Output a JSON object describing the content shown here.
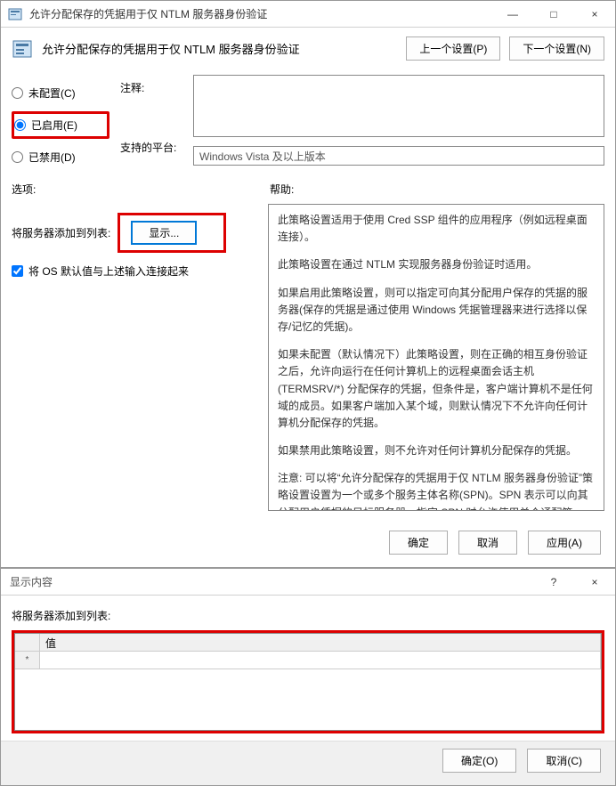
{
  "window": {
    "title": "允许分配保存的凭据用于仅 NTLM 服务器身份验证",
    "minimize": "—",
    "maximize": "□",
    "close": "×"
  },
  "header": {
    "title": "允许分配保存的凭据用于仅 NTLM 服务器身份验证",
    "prev_btn": "上一个设置(P)",
    "next_btn": "下一个设置(N)"
  },
  "radios": {
    "not_configured": "未配置(C)",
    "enabled": "已启用(E)",
    "disabled": "已禁用(D)"
  },
  "labels": {
    "comment": "注释:",
    "platform": "支持的平台:",
    "options": "选项:",
    "help": "帮助:"
  },
  "fields": {
    "comment_value": "",
    "platform_value": "Windows Vista 及以上版本"
  },
  "options": {
    "server_list_label": "将服务器添加到列表:",
    "show_btn": "显示...",
    "concat_checkbox": "将 OS 默认值与上述输入连接起来"
  },
  "help": {
    "p1": "此策略设置适用于使用 Cred SSP 组件的应用程序（例如远程桌面连接）。",
    "p2": "此策略设置在通过 NTLM 实现服务器身份验证时适用。",
    "p3": "如果启用此策略设置，则可以指定可向其分配用户保存的凭据的服务器(保存的凭据是通过使用 Windows 凭据管理器来进行选择以保存/记忆的凭据)。",
    "p4": "如果未配置（默认情况下）此策略设置，则在正确的相互身份验证之后，允许向运行在任何计算机上的远程桌面会话主机 (TERMSRV/*) 分配保存的凭据，但条件是，客户端计算机不是任何域的成员。如果客户端加入某个域，则默认情况下不允许向任何计算机分配保存的凭据。",
    "p5": "如果禁用此策略设置，则不允许对任何计算机分配保存的凭据。",
    "p6": "注意: 可以将“允许分配保存的凭据用于仅 NTLM 服务器身份验证”策略设置设置为一个或多个服务主体名称(SPN)。SPN 表示可以向其分配用户凭据的目标服务器。指定 SPN 时允许使用单个通配符。"
  },
  "buttons": {
    "ok": "确定",
    "cancel": "取消",
    "apply": "应用(A)"
  },
  "subdialog": {
    "title": "显示内容",
    "label": "将服务器添加到列表:",
    "col_header": "值",
    "row_marker": "*",
    "ok": "确定(O)",
    "cancel": "取消(C)"
  }
}
